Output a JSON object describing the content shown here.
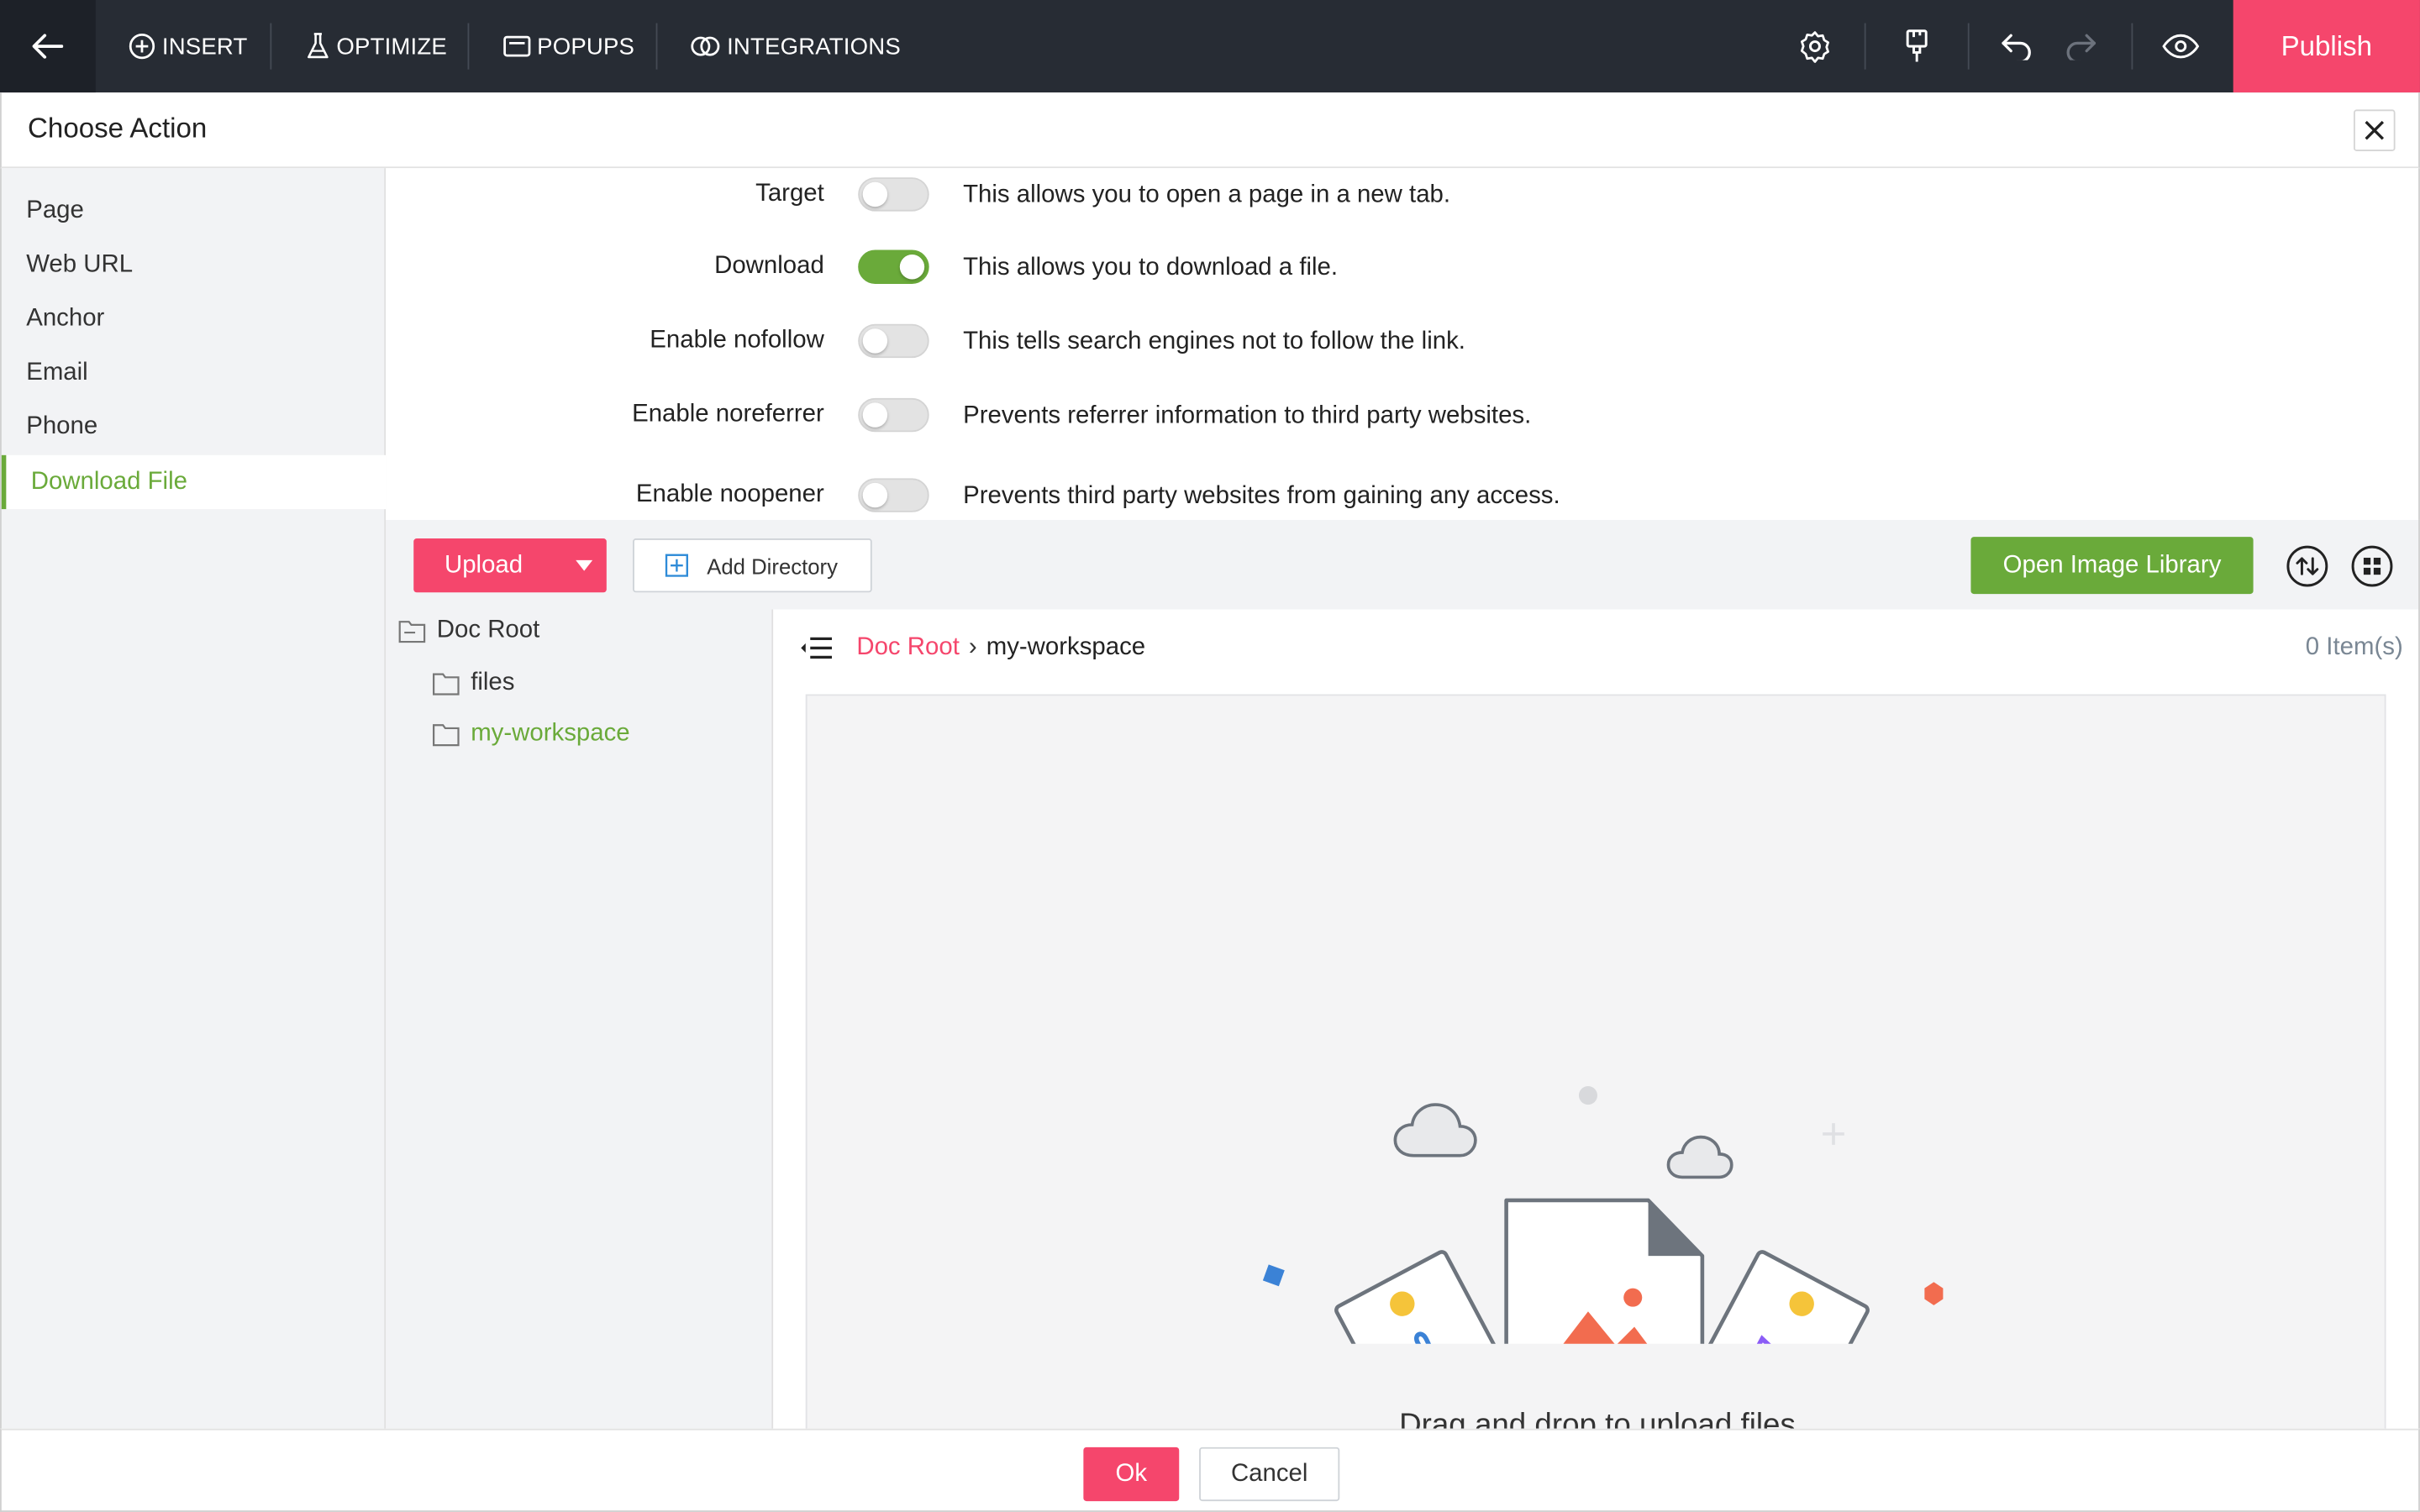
{
  "topbar": {
    "menu": [
      {
        "label": "INSERT",
        "icon": "plus-circle-icon"
      },
      {
        "label": "OPTIMIZE",
        "icon": "flask-icon"
      },
      {
        "label": "POPUPS",
        "icon": "popup-icon"
      },
      {
        "label": "INTEGRATIONS",
        "icon": "integrations-icon"
      }
    ],
    "publish_label": "Publish"
  },
  "dialog": {
    "title": "Choose Action"
  },
  "sidebar": {
    "items": [
      {
        "label": "Page"
      },
      {
        "label": "Web URL"
      },
      {
        "label": "Anchor"
      },
      {
        "label": "Email"
      },
      {
        "label": "Phone"
      },
      {
        "label": "Download File",
        "active": true
      }
    ]
  },
  "options": [
    {
      "label": "Target",
      "description": "This allows you to open a page in a new tab.",
      "enabled": false
    },
    {
      "label": "Download",
      "description": "This allows you to download a file.",
      "enabled": true
    },
    {
      "label": "Enable nofollow",
      "description": "This tells search engines not to follow the link.",
      "enabled": false
    },
    {
      "label": "Enable noreferrer",
      "description": "Prevents referrer information to third party websites.",
      "enabled": false
    },
    {
      "label": "Enable noopener",
      "description": "Prevents third party websites from gaining any access.",
      "enabled": false
    }
  ],
  "file_manager": {
    "upload_label": "Upload",
    "add_directory_label": "Add Directory",
    "open_library_label": "Open Image Library",
    "tree": {
      "root": "Doc Root",
      "children": [
        "files",
        "my-workspace"
      ],
      "active": "my-workspace"
    },
    "breadcrumb": {
      "root": "Doc Root",
      "separator": "›",
      "current": "my-workspace"
    },
    "item_count": "0 Item(s)",
    "drop_text": "Drag and drop to upload files"
  },
  "footer": {
    "ok_label": "Ok",
    "cancel_label": "Cancel"
  },
  "colors": {
    "accent_pink": "#f5466c",
    "accent_green": "#6aaa3a",
    "toolbar_bg": "#272c34"
  }
}
